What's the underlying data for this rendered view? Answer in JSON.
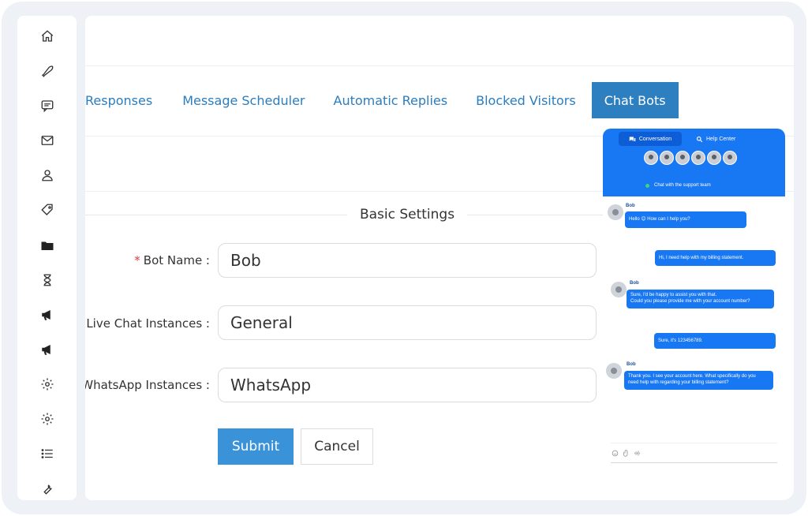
{
  "sidebar": {
    "icons": [
      "home-icon",
      "phone-icon",
      "chat-icon",
      "mail-icon",
      "user-icon",
      "tag-icon",
      "folder-icon",
      "hourglass-icon",
      "megaphone-icon",
      "megaphone-icon",
      "gear-icon",
      "gear-icon",
      "list-icon",
      "wrench-icon"
    ]
  },
  "tabs": [
    {
      "label": "Responses",
      "active": false
    },
    {
      "label": "Message Scheduler",
      "active": false
    },
    {
      "label": "Automatic Replies",
      "active": false
    },
    {
      "label": "Blocked Visitors",
      "active": false
    },
    {
      "label": "Chat Bots",
      "active": true
    }
  ],
  "form": {
    "section_title": "Basic Settings",
    "required_mark": "*",
    "bot_name_label": "Bot Name :",
    "bot_name_value": "Bob",
    "live_chat_label": "Live Chat Instances :",
    "live_chat_value": "General",
    "whatsapp_label": "WhatsApp Instances :",
    "whatsapp_value": "WhatsApp",
    "submit_label": "Submit",
    "cancel_label": "Cancel"
  },
  "chat": {
    "tab_conversation": "Conversation",
    "tab_help": "Help Center",
    "status": "Chat with the support team",
    "messages": [
      {
        "from": "bot",
        "sender": "Bob",
        "text": "Hello 😊 How can I help you?"
      },
      {
        "from": "user",
        "text": "Hi, I need help with my billing statement."
      },
      {
        "from": "bot",
        "sender": "Bob",
        "text": "Sure, I'd be happy to assist you with that.",
        "text2": "Could you please provide me with your account number?"
      },
      {
        "from": "user",
        "text": "Sure, it's 123456789."
      },
      {
        "from": "bot",
        "sender": "Bob",
        "text": "Thank you. I see your account here. What specifically do you",
        "text2": "need help with regarding your billing statement?"
      }
    ]
  },
  "colors": {
    "accent": "#2e7fc0",
    "chat_blue": "#1877f2",
    "required": "#e23b3b"
  }
}
